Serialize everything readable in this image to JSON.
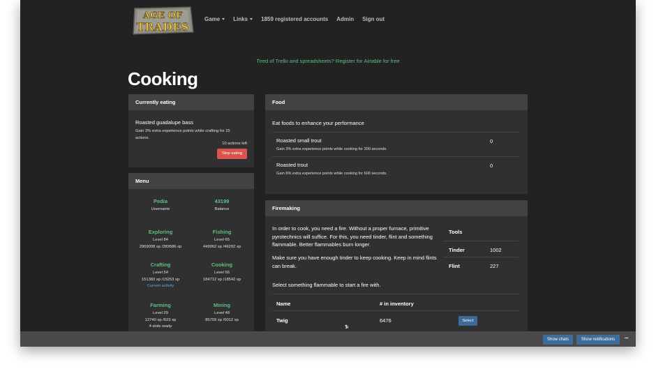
{
  "logo": {
    "text_top": "AGE OF",
    "text_bottom": "TRADES"
  },
  "nav": {
    "game": "Game",
    "links": "Links",
    "accounts": "1859 registered accounts",
    "admin": "Admin",
    "signout": "Sign out"
  },
  "ad_text": "Tired of Trello and spreadsheets? Register for Airtable for free",
  "page_title": "Cooking",
  "currently_eating": {
    "title": "Currently eating",
    "food": "Roasted guadalupe bass",
    "desc": "Gain 3% extra experience points while crafting for 15 actions.",
    "actions_left": "10 actions left",
    "stop_button": "Stop eating"
  },
  "menu": {
    "title": "Menu",
    "cells": [
      {
        "title": "Pedia",
        "line1": "Username",
        "line2": ""
      },
      {
        "title": "43199",
        "line1": "Balance",
        "line2": ""
      },
      {
        "title": "Exploring",
        "line1": "Level 84",
        "line2": "2969008 xp /289586 xp"
      },
      {
        "title": "Fishing",
        "line1": "Level 65",
        "line2": "449962 xp /46292 xp"
      },
      {
        "title": "Crafting",
        "line1": "Level 54",
        "line2": "151383 xp /15253 xp",
        "extra": "Current activity"
      },
      {
        "title": "Cooking",
        "line1": "Level 56",
        "line2": "184712 xp /18542 xp"
      },
      {
        "title": "Farming",
        "line1": "Level 29",
        "line2": "12740 xp /623 xp",
        "extra": "4 slots ready"
      },
      {
        "title": "Mining",
        "line1": "Level 48",
        "line2": "85709 xp /6012 xp"
      }
    ]
  },
  "food": {
    "title": "Food",
    "intro": "Eat foods to enhance your performance",
    "items": [
      {
        "name": "Roasted small trout",
        "desc": "Gain 3% extra experience points while cooking for 300 seconds.",
        "qty": "0"
      },
      {
        "name": "Roasted trout",
        "desc": "Gain 6% extra experience points while cooking for 600 seconds.",
        "qty": "0"
      }
    ]
  },
  "firemaking": {
    "title": "Firemaking",
    "para1": "In order to cook, you need a fire. Without a proper furnace, primitive pyrotechnics will suffice. For this, you need tinder, flint and something flammable. Better flammables burn longer.",
    "para2": "Make sure you have enough tinder to keep cooking. Keep in mind flints can break.",
    "select_text": "Select something flammable to start a fire with.",
    "tools": {
      "header": "Tools",
      "rows": [
        {
          "name": "Tinder",
          "value": "1002"
        },
        {
          "name": "Flint",
          "value": "227"
        }
      ]
    },
    "table": {
      "col_name": "Name",
      "col_inventory": "# in inventory",
      "rows": [
        {
          "name": "Twig",
          "mid": "1",
          "count": "6476",
          "button": "Select"
        }
      ]
    }
  },
  "bottom_bar": {
    "chats": "Show chats",
    "notifications": "Show notifications",
    "minimize": "–"
  },
  "colors": {
    "background": "#222222",
    "panel": "#303030",
    "panel_header": "#424242",
    "accent_green": "#5fbf85",
    "link_blue": "#5aa8e0",
    "danger": "#d9534f",
    "button_blue": "#3d6a96"
  }
}
